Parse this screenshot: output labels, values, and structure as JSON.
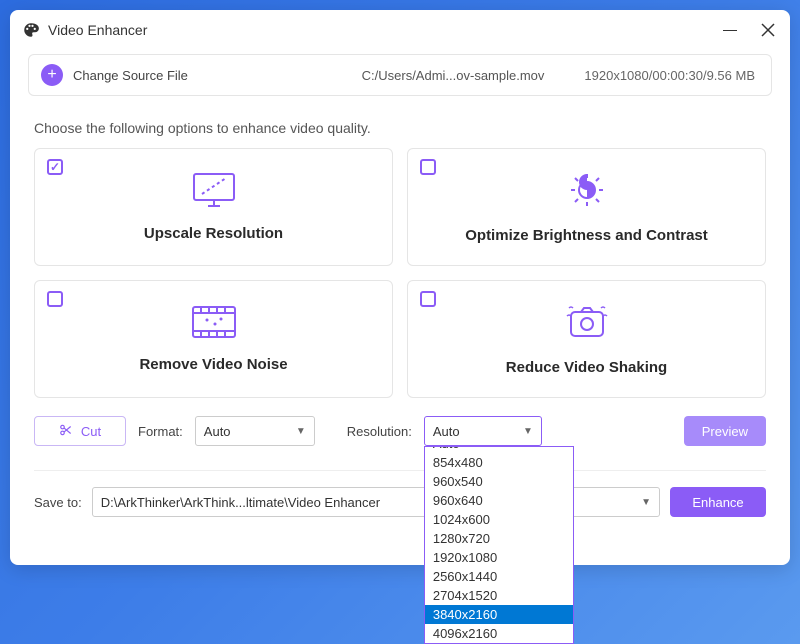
{
  "window": {
    "title": "Video Enhancer"
  },
  "source": {
    "change_label": "Change Source File",
    "path": "C:/Users/Admi...ov-sample.mov",
    "info": "1920x1080/00:00:30/9.56 MB"
  },
  "instruction": "Choose the following options to enhance video quality.",
  "options": {
    "upscale": {
      "label": "Upscale Resolution",
      "checked": true
    },
    "brightness": {
      "label": "Optimize Brightness and Contrast",
      "checked": false
    },
    "denoise": {
      "label": "Remove Video Noise",
      "checked": false
    },
    "stabilize": {
      "label": "Reduce Video Shaking",
      "checked": false
    }
  },
  "controls": {
    "cut_label": "Cut",
    "format_label": "Format:",
    "format_value": "Auto",
    "resolution_label": "Resolution:",
    "resolution_value": "Auto",
    "preview_label": "Preview",
    "enhance_label": "Enhance",
    "resolution_options": [
      "Auto",
      "854x480",
      "960x540",
      "960x640",
      "1024x600",
      "1280x720",
      "1920x1080",
      "2560x1440",
      "2704x1520",
      "3840x2160",
      "4096x2160"
    ],
    "resolution_highlight": "3840x2160"
  },
  "save": {
    "label": "Save to:",
    "path": "D:\\ArkThinker\\ArkThink...ltimate\\Video Enhancer"
  }
}
